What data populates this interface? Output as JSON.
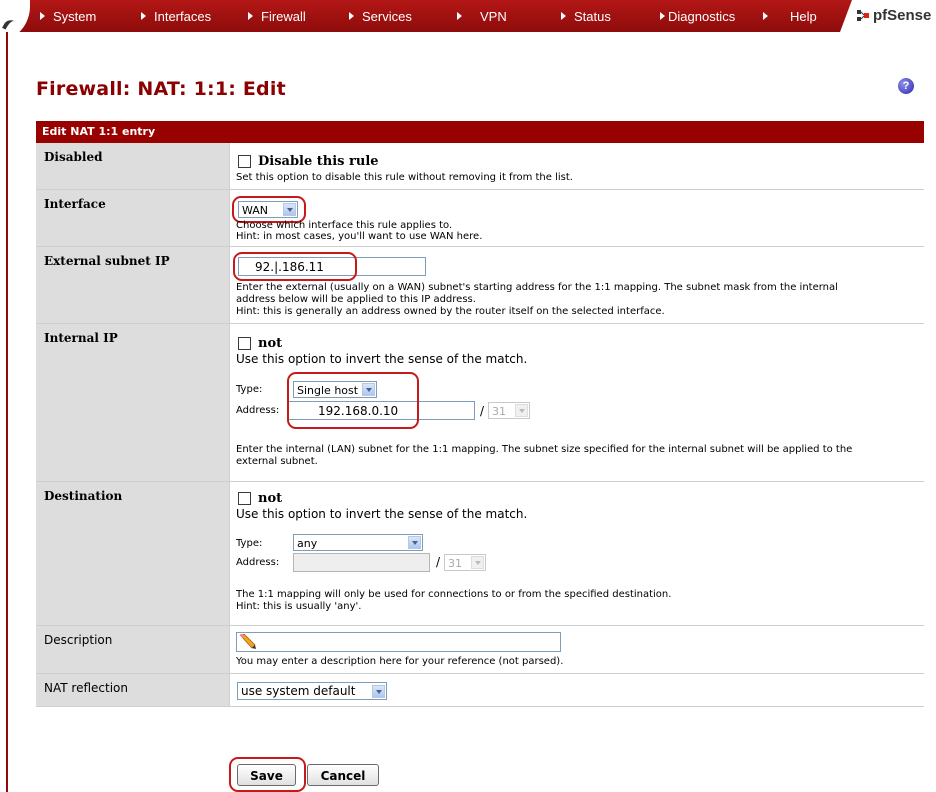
{
  "nav": {
    "items": [
      "System",
      "Interfaces",
      "Firewall",
      "Services",
      "VPN",
      "Status",
      "Diagnostics",
      "Help"
    ],
    "brand": "pfSense"
  },
  "page": {
    "title": "Firewall: NAT: 1:1: Edit",
    "help": "?"
  },
  "form": {
    "header": "Edit NAT 1:1 entry",
    "disabled": {
      "label": "Disabled",
      "checkbox_label": "Disable this rule",
      "hint": "Set this option to disable this rule without removing it from the list."
    },
    "interface": {
      "label": "Interface",
      "value": "WAN",
      "hint1": "Choose which interface this rule applies to.",
      "hint2": "Hint: in most cases, you'll want to use WAN here."
    },
    "external": {
      "label": "External subnet IP",
      "value": "92.|.186.11",
      "hint1": "Enter the external (usually on a WAN) subnet's starting address for the 1:1 mapping. The subnet mask from the internal",
      "hint2": "address below will be applied to this IP address.",
      "hint3": "Hint: this is generally an address owned by the router itself on the selected interface."
    },
    "internal": {
      "label": "Internal IP",
      "not_label": "not",
      "not_hint": "Use this option to invert the sense of the match.",
      "type_label": "Type:",
      "type_value": "Single host",
      "address_label": "Address:",
      "address_value": "192.168.0.10",
      "slash": "/",
      "mask": "31",
      "hint1": "Enter the internal (LAN) subnet for the 1:1 mapping. The subnet size specified for the internal subnet will be applied to the",
      "hint2": "external subnet."
    },
    "destination": {
      "label": "Destination",
      "not_label": "not",
      "not_hint": "Use this option to invert the sense of the match.",
      "type_label": "Type:",
      "type_value": "any",
      "address_label": "Address:",
      "address_value": "",
      "slash": "/",
      "mask": "31",
      "hint1": "The 1:1 mapping will only be used for connections to or from the specified destination.",
      "hint2": "Hint: this is usually 'any'."
    },
    "description": {
      "label": "Description",
      "value": "",
      "hint": "You may enter a description here for your reference (not parsed)."
    },
    "reflection": {
      "label": "NAT reflection",
      "value": "use system default"
    },
    "buttons": {
      "save": "Save",
      "cancel": "Cancel"
    }
  },
  "colors": {
    "nav": "#b31716",
    "header": "#990000",
    "title": "#8b0000",
    "highlight": "#c51a1a"
  }
}
